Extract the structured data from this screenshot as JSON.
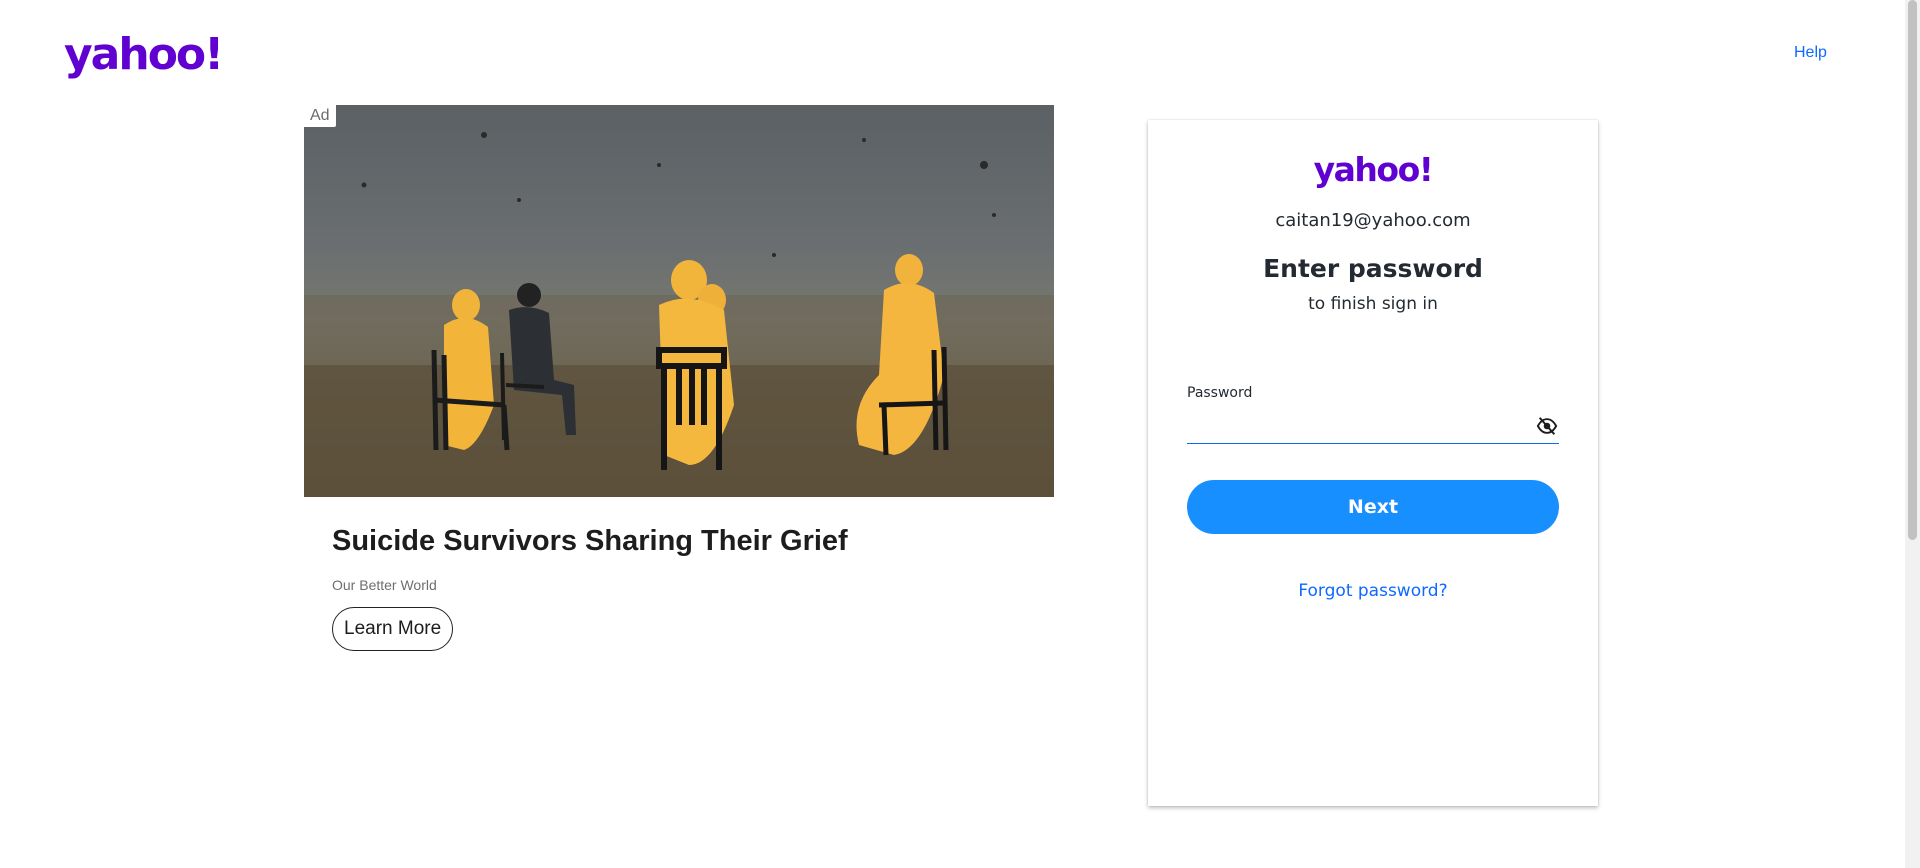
{
  "header": {
    "logo_text": "yahoo!",
    "help_label": "Help"
  },
  "ad": {
    "badge": "Ad",
    "title": "Suicide Survivors Sharing Their Grief",
    "sponsor": "Our Better World",
    "cta_label": "Learn More"
  },
  "login": {
    "logo_text": "yahoo!",
    "email": "caitan19@yahoo.com",
    "heading": "Enter password",
    "subheading": "to finish sign in",
    "password_label": "Password",
    "password_value": "",
    "next_label": "Next",
    "forgot_label": "Forgot password?"
  },
  "colors": {
    "brand_purple": "#6001d2",
    "link_blue": "#0f69ff",
    "button_blue": "#188fff"
  },
  "icons": {
    "show_password": "eye-slash-icon"
  }
}
